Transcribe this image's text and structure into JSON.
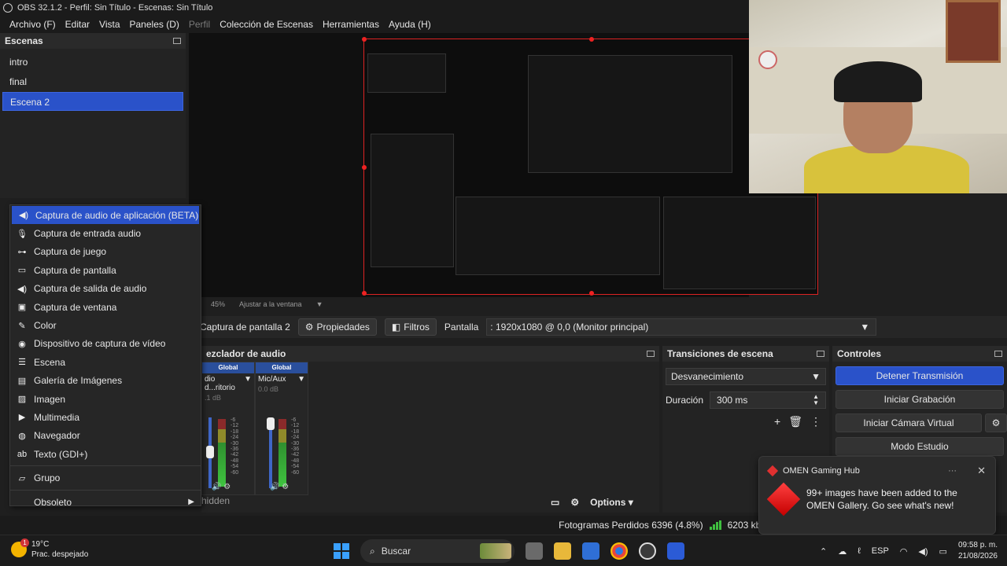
{
  "window": {
    "title": "OBS 32.1.2 - Perfil: Sin Título - Escenas: Sin Título"
  },
  "menubar": [
    {
      "label": "Archivo (F)",
      "disabled": false
    },
    {
      "label": "Editar",
      "disabled": false
    },
    {
      "label": "Vista",
      "disabled": false
    },
    {
      "label": "Paneles (D)",
      "disabled": false
    },
    {
      "label": "Perfil",
      "disabled": true
    },
    {
      "label": "Colección de Escenas",
      "disabled": false
    },
    {
      "label": "Herramientas",
      "disabled": false
    },
    {
      "label": "Ayuda (H)",
      "disabled": false
    }
  ],
  "scenes": {
    "title": "Escenas",
    "items": [
      "intro",
      "final",
      "Escena 2"
    ],
    "selected": "Escena 2"
  },
  "preview": {
    "zoom": "45%",
    "fit_label": "Ajustar a la ventana"
  },
  "source_toolbar": {
    "source_name": "Captura de pantalla 2",
    "properties": "Propiedades",
    "filters": "Filtros",
    "display_label": "Pantalla",
    "display_value": ": 1920x1080 @ 0,0 (Monitor principal)"
  },
  "context_menu": {
    "items": [
      {
        "label": "Captura de audio de aplicación (BETA)",
        "icon": "speaker-icon"
      },
      {
        "label": "Captura de entrada audio",
        "icon": "microphone-icon"
      },
      {
        "label": "Captura de juego",
        "icon": "gamepad-icon"
      },
      {
        "label": "Captura de pantalla",
        "icon": "monitor-icon"
      },
      {
        "label": "Captura de salida de audio",
        "icon": "speaker-icon"
      },
      {
        "label": "Captura de ventana",
        "icon": "window-icon"
      },
      {
        "label": "Color",
        "icon": "brush-icon"
      },
      {
        "label": "Dispositivo de captura de vídeo",
        "icon": "camera-icon"
      },
      {
        "label": "Escena",
        "icon": "list-icon"
      },
      {
        "label": "Galería de Imágenes",
        "icon": "gallery-icon"
      },
      {
        "label": "Imagen",
        "icon": "image-icon"
      },
      {
        "label": "Multimedia",
        "icon": "media-icon"
      },
      {
        "label": "Navegador",
        "icon": "globe-icon"
      },
      {
        "label": "Texto (GDI+)",
        "icon": "text-icon"
      }
    ],
    "group": "Grupo",
    "obsolete": "Obsoleto",
    "highlighted_index": 0
  },
  "mixer": {
    "title": "ezclador de audio",
    "channels": [
      {
        "header": "Global",
        "name": "dio d...ritorio",
        "db": ".1 dB",
        "level": 0.45
      },
      {
        "header": "Global",
        "name": "Mic/Aux",
        "db": "0.0 dB",
        "level": 0.98
      }
    ],
    "scale": [
      "-6",
      "-12",
      "-18",
      "-24",
      "-30",
      "-36",
      "-42",
      "-48",
      "-54",
      "-60"
    ],
    "hidden_label": "hidden",
    "options": "Options"
  },
  "transitions": {
    "title": "Transiciones de escena",
    "selected": "Desvanecimiento",
    "duration_label": "Duración",
    "duration_value": "300 ms"
  },
  "controls": {
    "title": "Controles",
    "stop_stream": "Detener Transmisión",
    "start_recording": "Iniciar Grabación",
    "start_virtual_cam": "Iniciar Cámara Virtual",
    "studio_mode": "Modo Estudio"
  },
  "status": {
    "dropped_frames": "Fotogramas Perdidos 6396 (4.8%)",
    "bitrate": "6203 kbps"
  },
  "toast": {
    "app": "OMEN Gaming Hub",
    "message": "99+ images have been added to the OMEN Gallery. Go see what's new!"
  },
  "taskbar": {
    "temperature": "19°C",
    "weather": "Prac. despejado",
    "weather_badge": "1",
    "search": "Buscar",
    "language": "ESP",
    "time": "09:58 p. m.",
    "date": "21/08/2026"
  },
  "colors": {
    "accent": "#2a52c9",
    "record_red": "#dd2222",
    "meter_green": "#3fc43f"
  }
}
